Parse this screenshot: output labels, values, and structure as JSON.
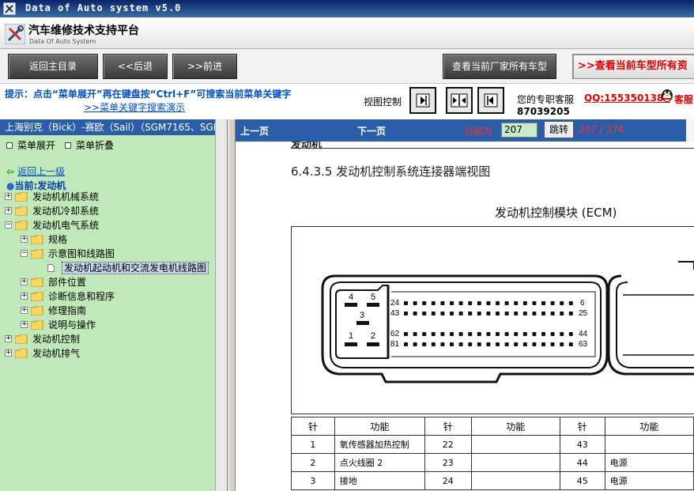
{
  "window": {
    "title": "Data of Auto system v5.0"
  },
  "header": {
    "name": "汽车维修技术支持平台",
    "subtitle": "Data Of Auto System"
  },
  "toolbar": {
    "home": "返回主目录",
    "back": "<<后退",
    "forward": ">>前进",
    "all_vendor_models": "查看当前厂家所有车型",
    "all_model_data": "查看当前车型所有资"
  },
  "hint": {
    "text": "提示：点击“菜单展开”再在键盘按“Ctrl+F”可搜索当前菜单关键字",
    "demo_link": ">>菜单关键字搜索演示",
    "view_control_label": "视图控制",
    "service_label": "您的专职客服",
    "qq": "QQ:1553501388",
    "service_suffix": "客服",
    "phone": "87039205"
  },
  "sidebar": {
    "breadcrumb": "上海别克（Bick）-赛欧（Sail）（SGM7165、SGM",
    "expand_label": "菜单展开",
    "collapse_label": "菜单折叠",
    "back_label": "返回上一级",
    "current_label": "当前:发动机",
    "tree": [
      {
        "label": "发动机机械系统"
      },
      {
        "label": "发动机冷却系统"
      },
      {
        "label": "发动机电气系统"
      },
      {
        "label": "规格"
      },
      {
        "label": "示意图和线路图"
      },
      {
        "label": "发动机起动机和交流发电机线路图"
      },
      {
        "label": "部件位置"
      },
      {
        "label": "诊断信息和程序"
      },
      {
        "label": "修理指南"
      },
      {
        "label": "说明与操作"
      },
      {
        "label": "发动机控制"
      },
      {
        "label": "发动机排气"
      }
    ]
  },
  "pager": {
    "prev": "上一页",
    "next": "下一页",
    "current_label": "当前为",
    "current_value": "207",
    "jump": "跳转",
    "total": "207 / 374"
  },
  "document": {
    "partial_heading": "发动机",
    "section_title": "6.4.3.5 发动机控制系统连接器端视图",
    "figure_title": "发动机控制模块 (ECM)",
    "connector_labels": {
      "p1": "1",
      "p2": "2",
      "p3": "3",
      "p4": "4",
      "p5": "5",
      "p24": "24",
      "p6": "6",
      "p43": "43",
      "p25": "25",
      "p62": "62",
      "p44": "44",
      "p81": "81",
      "p63": "63"
    },
    "table": {
      "headers": [
        "针",
        "功能",
        "针",
        "功能",
        "针",
        "功能"
      ],
      "rows": [
        [
          "1",
          "氧传感器加热控制",
          "22",
          "",
          "43",
          ""
        ],
        [
          "2",
          "点火线圈 2",
          "23",
          "",
          "44",
          "电源"
        ],
        [
          "3",
          "接地",
          "24",
          "",
          "45",
          "电源"
        ]
      ]
    }
  }
}
